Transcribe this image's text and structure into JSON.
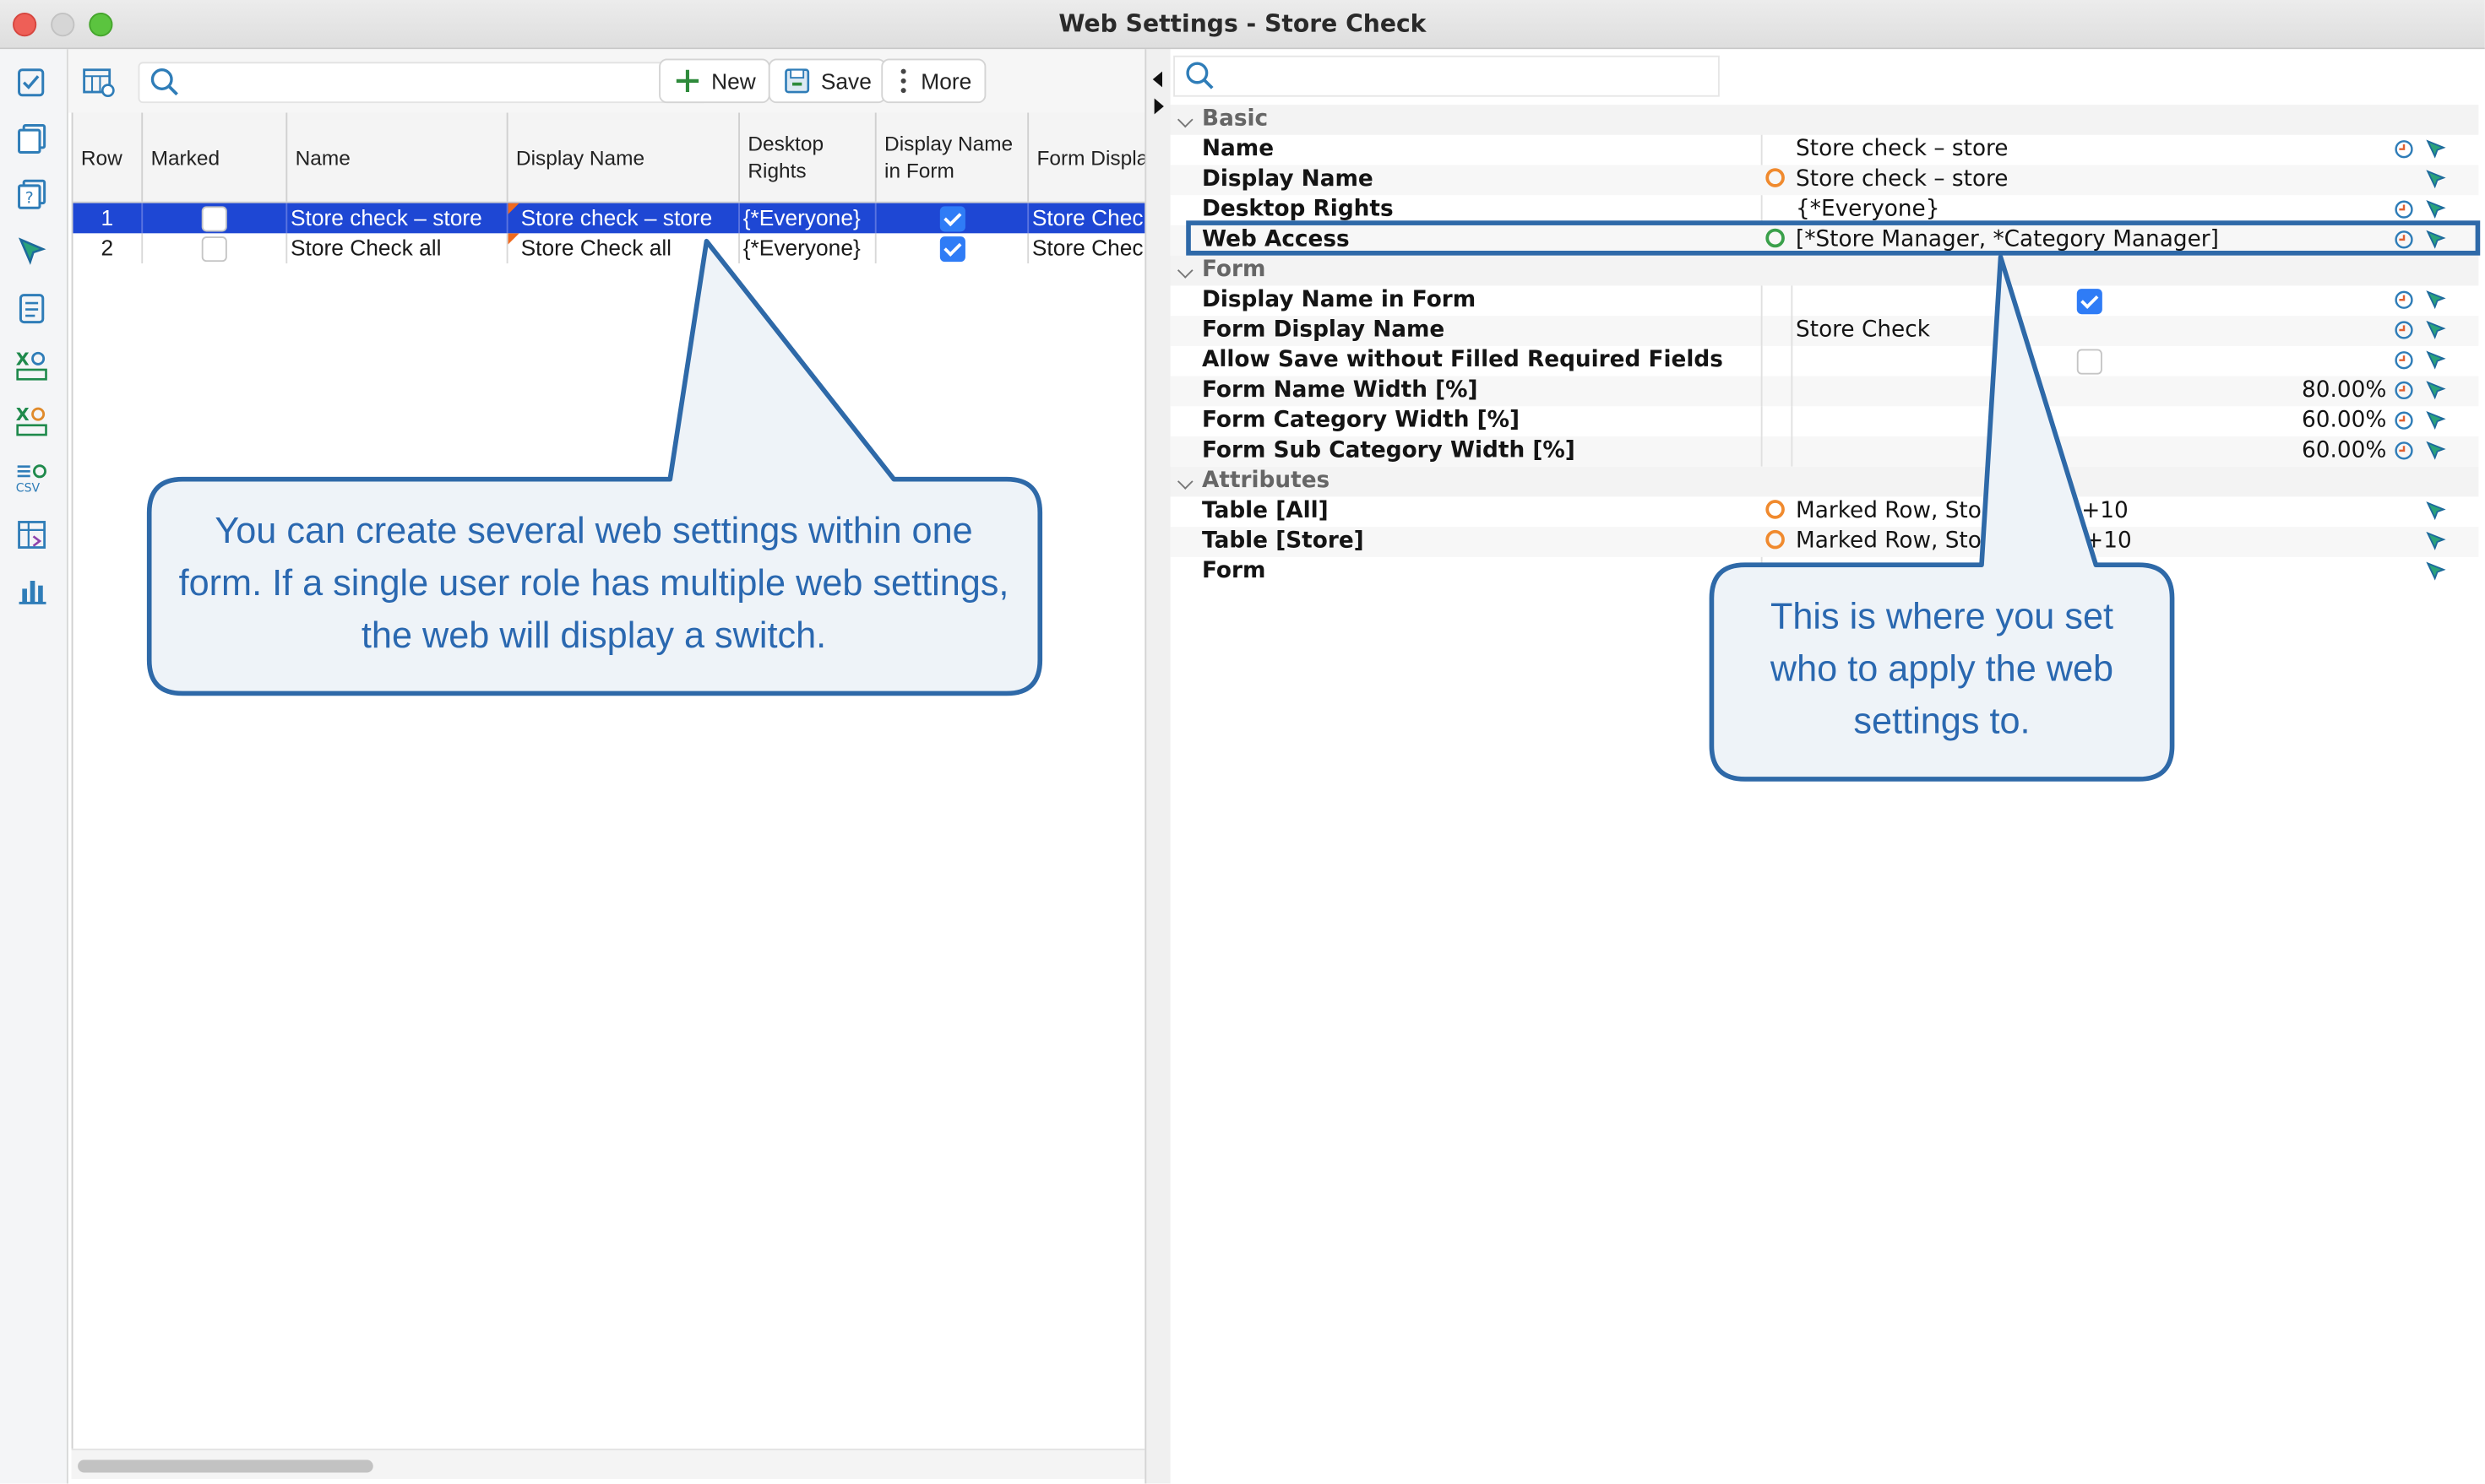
{
  "window": {
    "title": "Web Settings - Store Check"
  },
  "toolbar": {
    "search_placeholder": "",
    "new_label": "New",
    "save_label": "Save",
    "more_label": "More"
  },
  "table": {
    "columns": [
      "Row",
      "Marked",
      "Name",
      "Display Name",
      "Desktop Rights",
      "Display Name in Form",
      "Form Displa"
    ],
    "rows": [
      {
        "row": "1",
        "marked": false,
        "name": "Store check – store",
        "display_name": "Store check – store",
        "desktop_rights": "{*Everyone}",
        "display_in_form": true,
        "form_display": "Store Chec",
        "selected": true
      },
      {
        "row": "2",
        "marked": false,
        "name": "Store Check all",
        "display_name": "Store Check all",
        "desktop_rights": "{*Everyone}",
        "display_in_form": true,
        "form_display": "Store Chec",
        "selected": false
      }
    ]
  },
  "properties": {
    "search_placeholder": "",
    "categories": [
      {
        "name": "Basic",
        "items": [
          {
            "name": "Name",
            "value": "Store check – store"
          },
          {
            "name": "Display Name",
            "value": "Store check – store"
          },
          {
            "name": "Desktop Rights",
            "value": "{*Everyone}"
          },
          {
            "name": "Web Access",
            "value": "[*Store Manager, *Category Manager]"
          }
        ]
      },
      {
        "name": "Form",
        "items": [
          {
            "name": "Display Name in Form",
            "checked": true
          },
          {
            "name": "Form Display Name",
            "value": "Store Check"
          },
          {
            "name": "Allow Save without Filled Required Fields",
            "checked": false
          },
          {
            "name": "Form Name Width [%]",
            "value": "80.00%"
          },
          {
            "name": "Form Category Width [%]",
            "value": "60.00%"
          },
          {
            "name": "Form Sub Category Width [%]",
            "value": "60.00%"
          }
        ]
      },
      {
        "name": "Attributes",
        "items": [
          {
            "name": "Table [All]",
            "value": "Marked Row, Sto",
            "suffix": ", +10"
          },
          {
            "name": "Table [Store]",
            "value": "Marked Row, Sto",
            "suffix": "+10"
          },
          {
            "name": "Form",
            "value": ""
          }
        ]
      }
    ]
  },
  "callouts": {
    "left": "You can create several web settings within one form. If a single user role has multiple web settings, the web will display a switch.",
    "right": "This is where you set who to apply the web settings to."
  },
  "colors": {
    "selection": "#1e47d4",
    "callout_border": "#2e69a8",
    "callout_fill": "#eef3f8",
    "callout_text": "#2a68b0",
    "checkbox": "#2f7cf6"
  }
}
